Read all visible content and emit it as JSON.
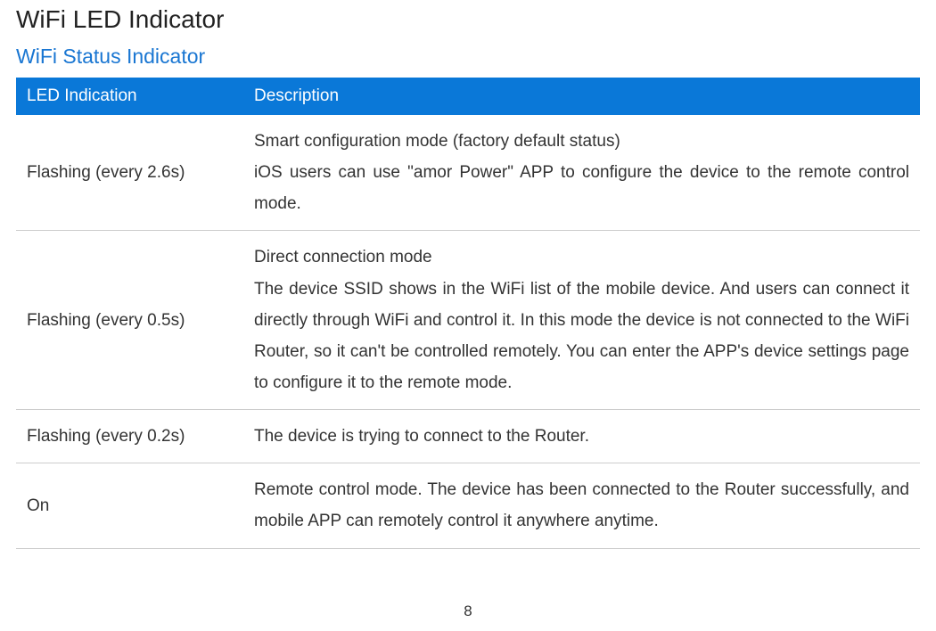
{
  "page_title": "WiFi LED Indicator",
  "subtitle": "WiFi Status Indicator",
  "table": {
    "headers": {
      "col1": "LED Indication",
      "col2": "Description"
    },
    "rows": [
      {
        "indication": "Flashing (every 2.6s)",
        "description": "Smart configuration mode (factory default status)\niOS users can use \"amor Power\" APP to configure the device to the remote control mode."
      },
      {
        "indication": "Flashing (every 0.5s)",
        "description": "Direct connection mode\nThe device SSID shows in the WiFi list of the mobile device. And users can connect it directly through WiFi and control it. In this mode the device is not connected to the WiFi Router, so it can't be controlled remotely. You can enter the APP's device settings page to configure it to the remote mode."
      },
      {
        "indication": "Flashing (every 0.2s)",
        "description": "The device is trying to connect to the Router."
      },
      {
        "indication": "On",
        "description": "Remote control mode. The device has been connected to the Router successfully, and mobile APP can remotely control it anywhere anytime."
      }
    ]
  },
  "page_number": "8"
}
